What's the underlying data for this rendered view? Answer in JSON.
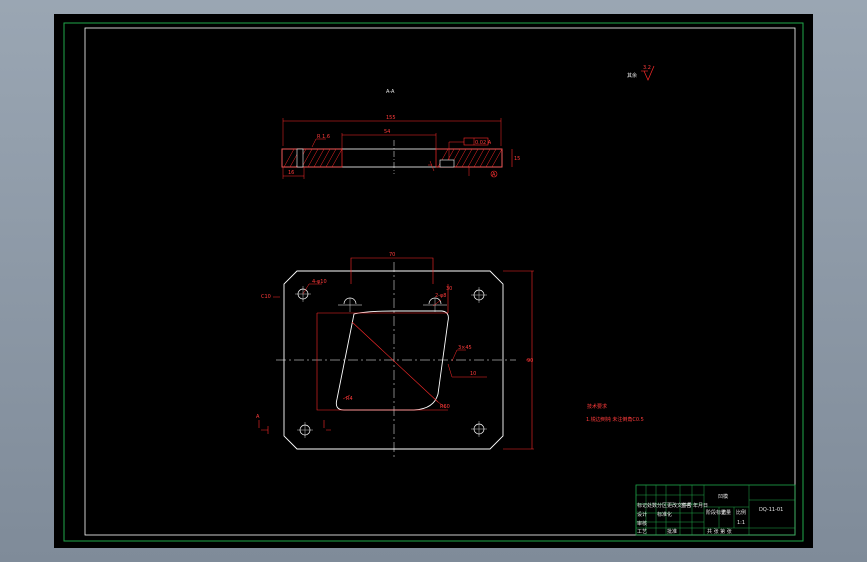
{
  "drawing": {
    "roughness_mark": "3.2",
    "roughness_note": "其余",
    "section_label": "A-A",
    "top_dims": {
      "overall_width": "155",
      "opening_width": "54",
      "tolerance_box": "0.02 A",
      "datum_marker": "A",
      "thickness": "15",
      "left_step": "R 1.6",
      "left_bottom": "16"
    },
    "plan_dims": {
      "top_opening": "70",
      "right_side": "30",
      "right_height": "90",
      "hole_label_left": "4-φ10",
      "hole_label_top": "2-φ8",
      "chamfer": "C10",
      "radius_small": "R4",
      "diagonal": "R60",
      "center_offset": "3×45",
      "right_offset": "10",
      "bottom_marker": "A"
    },
    "notes": {
      "title": "技术要求",
      "line1": "1.锐边倒钝 未注倒角C0.5"
    },
    "title_block": {
      "part_name": "凹模",
      "drawing_no": "DQ-11-01",
      "cells_left": [
        "标记",
        "处数",
        "分区",
        "更改文件号",
        "签名",
        "年月日"
      ],
      "row2": [
        "设计",
        "",
        "标准化"
      ],
      "row3": [
        "审核"
      ],
      "row4": [
        "工艺",
        "",
        "批准"
      ],
      "stage_labels": [
        "阶段标记",
        "重量",
        "比例"
      ],
      "sheet": "共 张 第 张",
      "scale": "1:1"
    }
  }
}
